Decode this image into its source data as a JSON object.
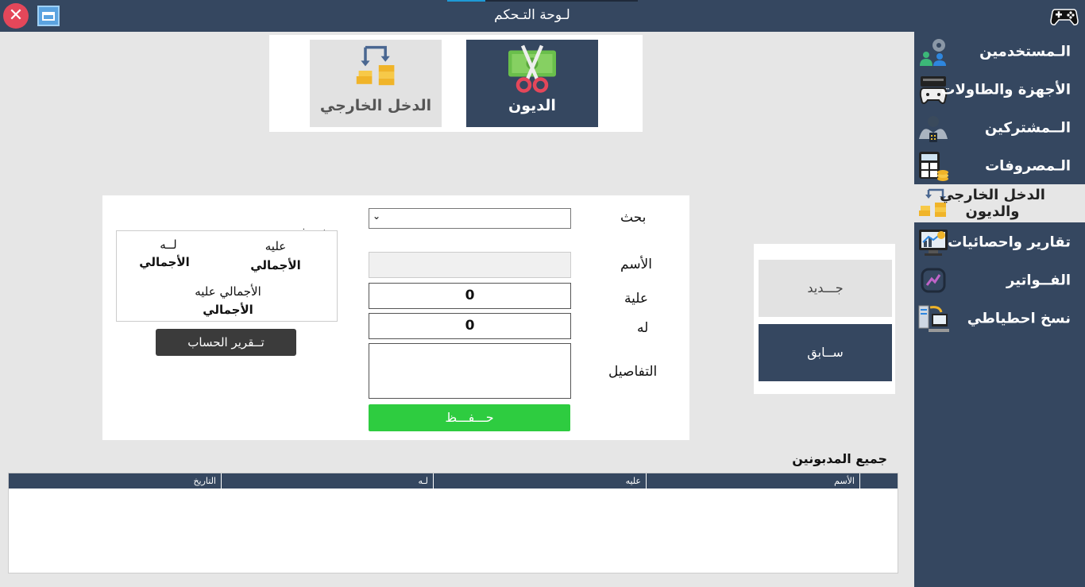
{
  "window": {
    "title": "لـوحة التـحكم",
    "close_glyph": "✕"
  },
  "sidebar": {
    "items": [
      {
        "label": "الـمستخدمين",
        "icon": "users-gear-icon"
      },
      {
        "label": "الأجهزة والطاولات",
        "icon": "console-gamepad-icon"
      },
      {
        "label": "الــمشتركين",
        "icon": "subscribers-icon"
      },
      {
        "label": "الـمصروفات",
        "icon": "calculator-coins-icon"
      },
      {
        "label": "الدخل الخارجي والديون",
        "icon": "income-transfer-icon",
        "active": true
      },
      {
        "label": "تقارير واحصائيات",
        "icon": "statistics-monitor-icon"
      },
      {
        "label": "الفــواتير",
        "icon": "invoice-chart-icon"
      },
      {
        "label": "نسخ احطياطي",
        "icon": "backup-icon"
      }
    ]
  },
  "tiles": {
    "income": {
      "label": "الدخل الخارجي"
    },
    "debts": {
      "label": "الديون"
    }
  },
  "form": {
    "search_label": "بحث",
    "search_chevron": "⌄",
    "name_label": "الأسم",
    "alayh_label": "علية",
    "alayh_value": "0",
    "lah_label": "له",
    "lah_value": "0",
    "details_label": "التفاصيل",
    "save_label": "حـــفـــظ"
  },
  "summary": {
    "title": "نــبذه",
    "lah_heading": "لــه",
    "lah_total": "الأجمالي",
    "alayh_heading": "عليه",
    "alayh_total": "الأجمالي",
    "net_heading": "الأجمالي عليه",
    "net_total": "الأجمالي",
    "report_label": "تــقرير الحساب"
  },
  "nav": {
    "new_label": "جـــديد",
    "prev_label": "ســابق"
  },
  "table": {
    "title": "جميع المدبونين",
    "columns": [
      "الأسم",
      "عليه",
      "لـه",
      "التاريخ"
    ]
  },
  "colors": {
    "navy": "#354760",
    "green": "#2ecc40",
    "close_red": "#e4475a"
  }
}
